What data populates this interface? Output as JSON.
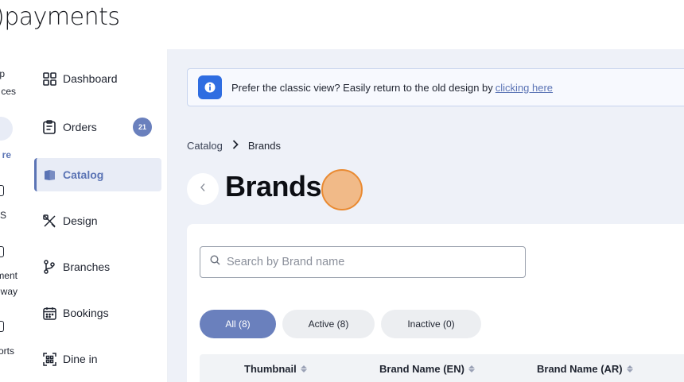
{
  "logo": {
    "text": "payments"
  },
  "rail": {
    "items": [
      {
        "line1": "p",
        "line2": "ces"
      },
      {
        "line1": "re",
        "active": true
      },
      {
        "line1": "S"
      },
      {
        "line1": "ment",
        "line2": "way"
      },
      {
        "line1": "orts"
      }
    ]
  },
  "sidebar": {
    "items": [
      {
        "label": "Dashboard",
        "icon": "dashboard-icon"
      },
      {
        "label": "Orders",
        "icon": "orders-icon",
        "badge": "21"
      },
      {
        "label": "Catalog",
        "icon": "catalog-icon",
        "active": true
      },
      {
        "label": "Design",
        "icon": "design-icon"
      },
      {
        "label": "Branches",
        "icon": "branches-icon"
      },
      {
        "label": "Bookings",
        "icon": "calendar-icon"
      },
      {
        "label": "Dine in",
        "icon": "qr-icon"
      }
    ]
  },
  "banner": {
    "text": "Prefer the classic view? Easily return to the old design by",
    "link": "clicking here"
  },
  "breadcrumb": {
    "parent": "Catalog",
    "current": "Brands"
  },
  "page": {
    "title": "Brands"
  },
  "search": {
    "placeholder": "Search by Brand name"
  },
  "filters": [
    {
      "label": "All (8)",
      "selected": true
    },
    {
      "label": "Active (8)"
    },
    {
      "label": "Inactive (0)"
    }
  ],
  "table": {
    "headers": [
      "Thumbnail",
      "Brand Name (EN)",
      "Brand Name (AR)"
    ]
  },
  "colors": {
    "accent": "#6a80bd",
    "info": "#2f6de1",
    "background": "#eef1f8"
  }
}
